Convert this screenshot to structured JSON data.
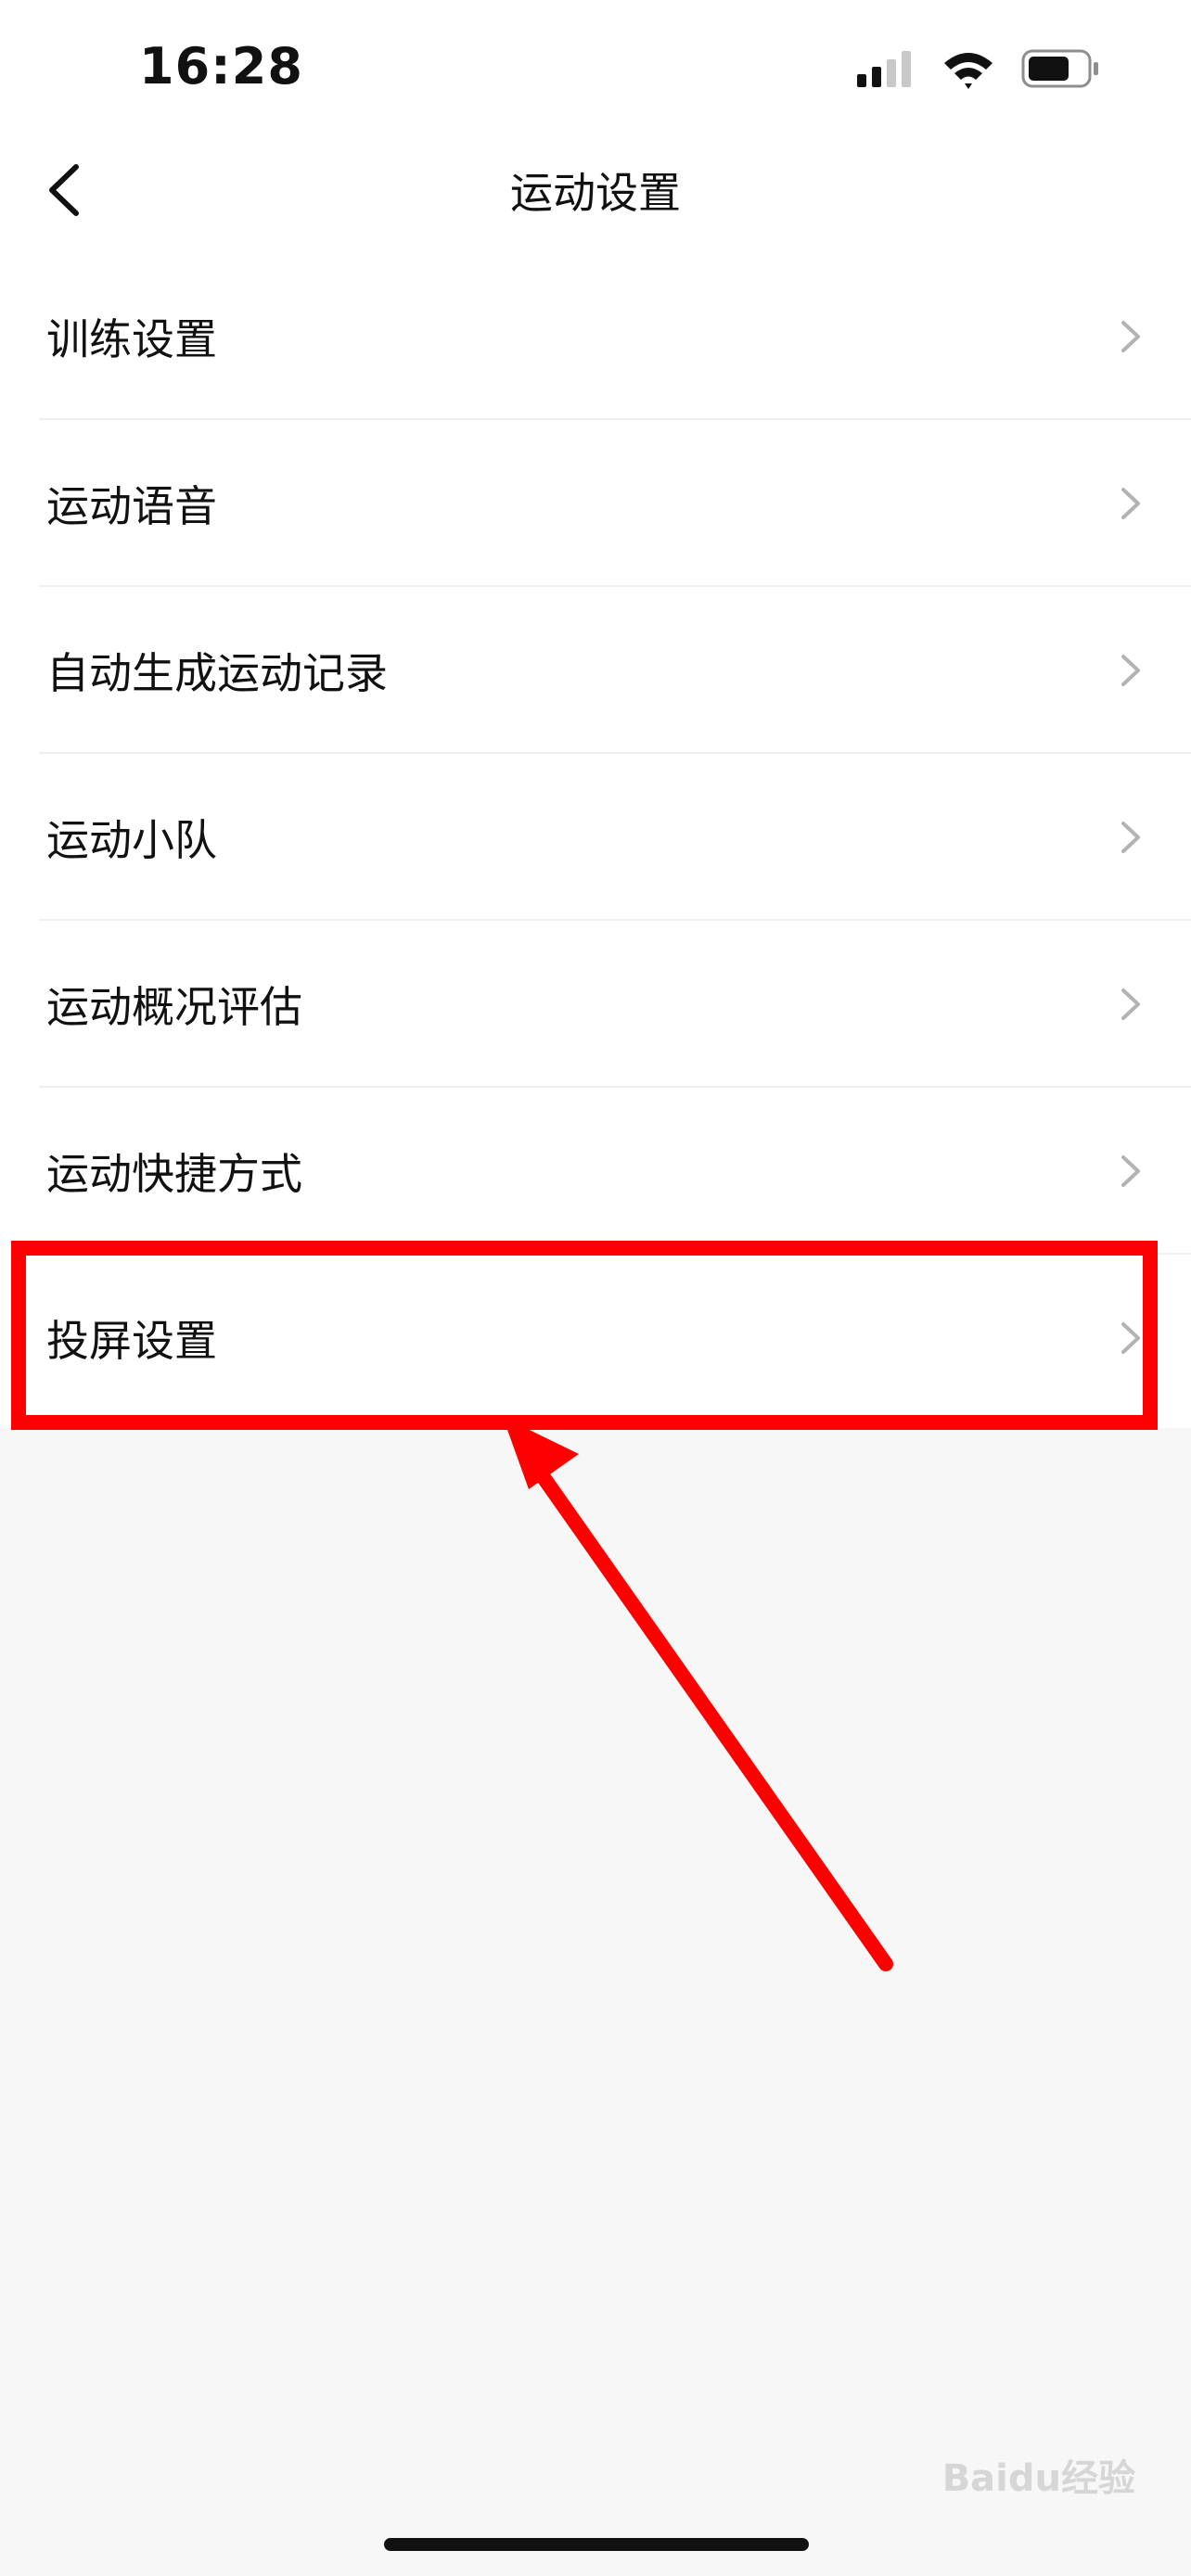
{
  "status_bar": {
    "time": "16:28",
    "battery_level": 0.72
  },
  "nav": {
    "title": "运动设置",
    "back_icon": "chevron-left-icon"
  },
  "items": [
    {
      "label": "训练设置"
    },
    {
      "label": "运动语音"
    },
    {
      "label": "自动生成运动记录"
    },
    {
      "label": "运动小队"
    },
    {
      "label": "运动概况评估"
    },
    {
      "label": "运动快捷方式"
    },
    {
      "label": "投屏设置"
    }
  ],
  "annotation": {
    "color": "#ff0000",
    "highlighted_item": "投屏设置"
  },
  "watermark": {
    "text": "Baidu经验"
  },
  "colors": {
    "list_background": "#ffffff",
    "page_background": "#f7f7f7",
    "chevron": "#b3b3b3"
  }
}
